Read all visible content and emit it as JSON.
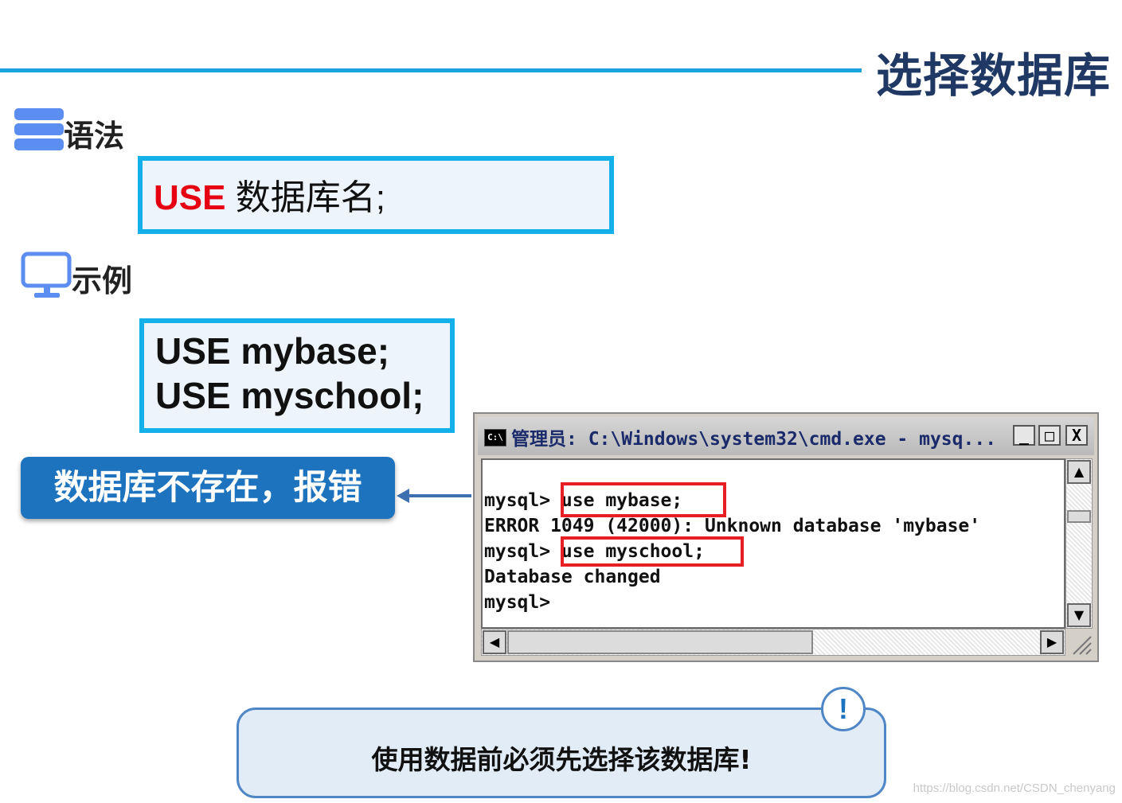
{
  "title": "选择数据库",
  "syntax": {
    "heading": "语法",
    "icon": "server-stack-icon",
    "keyword": "USE",
    "rest": " 数据库名;",
    "keyword_color": "#e60012"
  },
  "example": {
    "heading": "示例",
    "icon": "monitor-icon",
    "lines": [
      "USE mybase;",
      "USE myschool;"
    ]
  },
  "callout": {
    "text": "数据库不存在，报错",
    "color": "#1e73be"
  },
  "terminal": {
    "icon_label": "C:\\",
    "title": "管理员: C:\\Windows\\system32\\cmd.exe - mysq...",
    "buttons": {
      "minimize": "_",
      "maximize": "□",
      "close": "X"
    },
    "lines": [
      "mysql> use mybase;",
      "ERROR 1049 (42000): Unknown database 'mybase'",
      "mysql> use myschool;",
      "Database changed",
      "mysql>"
    ]
  },
  "note": {
    "text": "使用数据前必须先选择该数据库!",
    "alert_symbol": "!"
  },
  "watermark": "https://blog.csdn.net/CSDN_chenyang",
  "colors": {
    "accent": "#1aa3df",
    "title": "#1f3864",
    "box_border": "#14b0ea",
    "highlight": "#e81e25"
  }
}
